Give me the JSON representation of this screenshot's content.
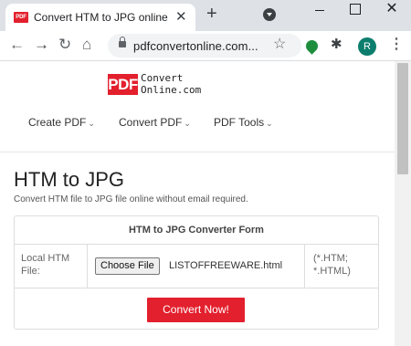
{
  "browser": {
    "tab_title": "Convert HTM to JPG online",
    "tab_favicon_text": "PDF",
    "url": "pdfconvertonline.com...",
    "avatar_letter": "R",
    "icons": {
      "close": "close-icon",
      "new_tab": "plus-icon",
      "back": "arrow-left-icon",
      "forward": "arrow-right-icon",
      "reload": "reload-icon",
      "home": "home-icon",
      "lock": "lock-icon",
      "star": "star-icon",
      "extension": "puzzle-icon",
      "menu": "kebab-menu-icon"
    },
    "accent_avatar_color": "#0d7e6d"
  },
  "site": {
    "logo": {
      "badge": "PDF",
      "line1": "Convert",
      "line2": "Online.com"
    },
    "nav": [
      {
        "label": "Create PDF"
      },
      {
        "label": "Convert PDF"
      },
      {
        "label": "PDF Tools"
      }
    ],
    "brand_color": "#e3202d"
  },
  "main": {
    "title": "HTM to JPG",
    "subtitle": "Convert HTM file to JPG file online without email required.",
    "form": {
      "header": "HTM to JPG Converter Form",
      "file_label": "Local HTM File:",
      "choose_button": "Choose File",
      "file_name": "LISTOFFREEWARE.html",
      "extensions_line1": "(*.HTM;",
      "extensions_line2": "*.HTML)",
      "submit_label": "Convert Now!"
    }
  }
}
